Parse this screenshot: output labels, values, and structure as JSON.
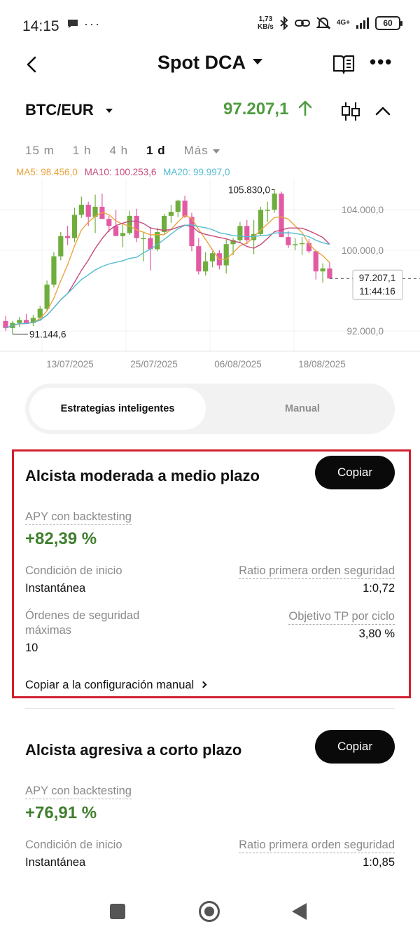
{
  "status": {
    "time": "14:15",
    "speed_top": "1,73",
    "speed_bottom": "KB/s",
    "network": "4G+",
    "battery": "60"
  },
  "header": {
    "title": "Spot DCA"
  },
  "pair": {
    "name": "BTC/EUR",
    "price": "97.207,1"
  },
  "timeframes": [
    "15 m",
    "1 h",
    "4 h",
    "1 d",
    "Más"
  ],
  "active_timeframe": "1 d",
  "indicators": {
    "ma5": "MA5: 98.456,0",
    "ma10": "MA10: 100.253,6",
    "ma20": "MA20: 99.997,0"
  },
  "chart_data": {
    "type": "candlestick",
    "x_ticks": [
      "13/07/2025",
      "25/07/2025",
      "06/08/2025",
      "18/08/2025"
    ],
    "y_ticks": [
      "104.000,0",
      "100.000,0",
      "92.000,0"
    ],
    "ylim": [
      90000,
      107000
    ],
    "high_label": "105.830,0",
    "low_label": "91.144,6",
    "last_price_label": "97.207,1",
    "countdown_label": "11:44:16",
    "colors": {
      "up": "#6fae3d",
      "down": "#e25ba2",
      "ma5": "#e9a43f",
      "ma10": "#c64a7e",
      "ma20": "#54bcd0"
    },
    "candles": [
      [
        93000,
        93500,
        92000,
        92300
      ],
      [
        92300,
        93000,
        91700,
        92800
      ],
      [
        92800,
        93400,
        92400,
        93100
      ],
      [
        93100,
        93700,
        92900,
        92800
      ],
      [
        92800,
        93600,
        92500,
        93300
      ],
      [
        93300,
        94500,
        93000,
        94200
      ],
      [
        94200,
        97000,
        94000,
        96600
      ],
      [
        96600,
        99800,
        96300,
        99400
      ],
      [
        99400,
        101800,
        99000,
        101400
      ],
      [
        101400,
        102400,
        100500,
        101200
      ],
      [
        101200,
        104200,
        100800,
        103500
      ],
      [
        103500,
        105300,
        103200,
        104500
      ],
      [
        104500,
        104800,
        102400,
        103300
      ],
      [
        103300,
        105500,
        101700,
        104300
      ],
      [
        104300,
        105600,
        103100,
        103100
      ],
      [
        103100,
        103400,
        101800,
        102400
      ],
      [
        102400,
        104000,
        101400,
        101400
      ],
      [
        101400,
        102500,
        100300,
        101700
      ],
      [
        101700,
        103900,
        101500,
        103400
      ],
      [
        103400,
        104100,
        100800,
        101200
      ],
      [
        101200,
        101800,
        98900,
        101200
      ],
      [
        101200,
        102300,
        98000,
        100100
      ],
      [
        100100,
        102200,
        99900,
        101800
      ],
      [
        101800,
        103600,
        101500,
        103400
      ],
      [
        103400,
        104500,
        102700,
        103800
      ],
      [
        103800,
        105000,
        103300,
        104900
      ],
      [
        104900,
        105400,
        103200,
        103300
      ],
      [
        103300,
        103700,
        99900,
        100400
      ],
      [
        100400,
        101200,
        97600,
        97900
      ],
      [
        97900,
        99800,
        97500,
        98900
      ],
      [
        98900,
        99900,
        98300,
        99700
      ],
      [
        99700,
        100000,
        98100,
        98500
      ],
      [
        98500,
        101100,
        97700,
        100600
      ],
      [
        100600,
        101200,
        99500,
        101000
      ],
      [
        101000,
        102800,
        100700,
        102400
      ],
      [
        102400,
        103000,
        100600,
        101000
      ],
      [
        101000,
        103000,
        99600,
        101600
      ],
      [
        101600,
        104300,
        101400,
        104000
      ],
      [
        104000,
        104800,
        102800,
        104000
      ],
      [
        104000,
        106000,
        103700,
        105600
      ],
      [
        105600,
        105800,
        101300,
        101300
      ],
      [
        101300,
        101900,
        100200,
        100500
      ],
      [
        100500,
        101200,
        100000,
        100600
      ],
      [
        100600,
        101300,
        99500,
        100700
      ],
      [
        100700,
        101100,
        99700,
        99900
      ],
      [
        99900,
        100000,
        97100,
        97900
      ],
      [
        97900,
        98700,
        96800,
        98200
      ],
      [
        98200,
        98800,
        97500,
        97200
      ]
    ]
  },
  "tabs": {
    "smart": "Estrategias inteligentes",
    "manual": "Manual"
  },
  "strategies": [
    {
      "title": "Alcista moderada a medio plazo",
      "copy": "Copiar",
      "apy_label": "APY con backtesting",
      "apy": "+82,39 %",
      "start_label": "Condición de inicio",
      "start_value": "Instantánea",
      "ratio_label": "Ratio primera orden seguridad",
      "ratio_value": "1:0,72",
      "max_orders_label_1": "Órdenes de seguridad",
      "max_orders_label_2": "máximas",
      "max_orders_value": "10",
      "tp_label": "Objetivo TP por ciclo",
      "tp_value": "3,80 %",
      "manual_link": "Copiar a la configuración manual"
    },
    {
      "title": "Alcista agresiva a corto plazo",
      "copy": "Copiar",
      "apy_label": "APY con backtesting",
      "apy": "+76,91 %",
      "start_label": "Condición de inicio",
      "start_value": "Instantánea",
      "ratio_label": "Ratio primera orden seguridad",
      "ratio_value": "1:0,85"
    }
  ]
}
